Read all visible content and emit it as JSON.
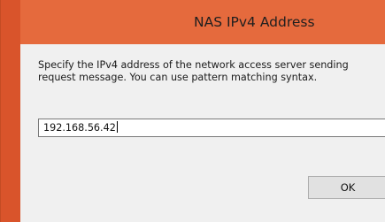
{
  "dialog": {
    "title": "NAS IPv4 Address",
    "instructions": "Specify the IPv4 address of the network access server sending\nrequest message.  You can use pattern matching syntax.",
    "address_value": "192.168.56.42",
    "ok_label": "OK"
  },
  "colors": {
    "titlebar": "#e56a3d",
    "frame": "#d9542b",
    "client_background": "#f0f0f0"
  }
}
